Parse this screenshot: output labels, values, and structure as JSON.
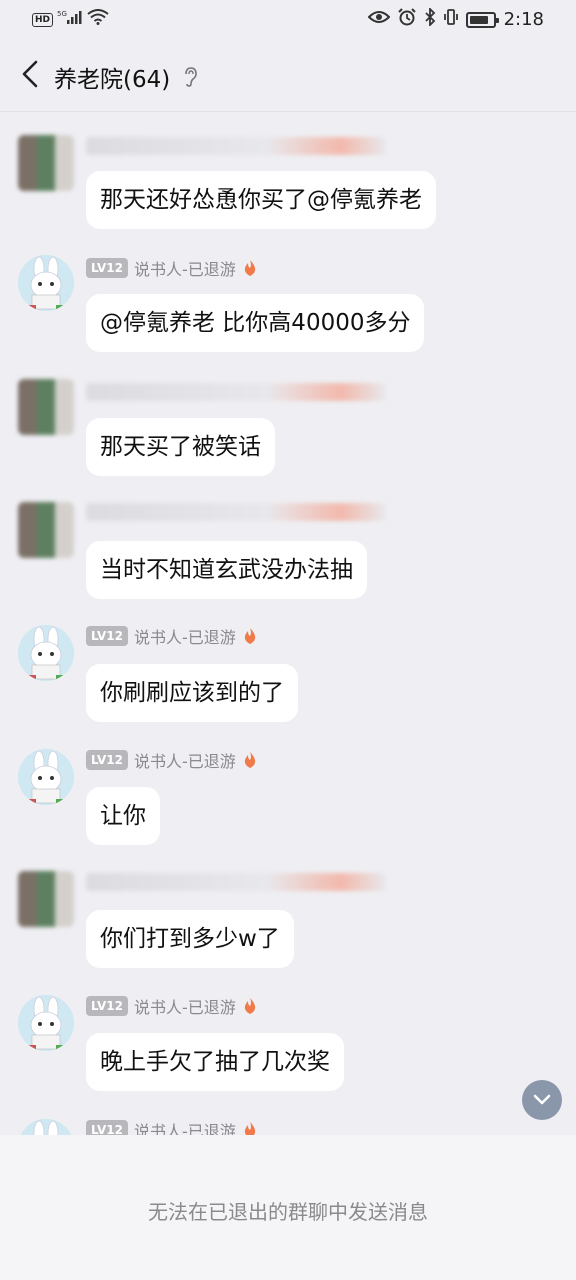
{
  "status_bar": {
    "network_badge": "HD",
    "network_type": "5G",
    "time": "2:18"
  },
  "header": {
    "title": "养老院(64)",
    "back_icon": "chevron-left-icon",
    "mode_icon": "ear-icon"
  },
  "messages": [
    {
      "sender_visible": false,
      "text": "那天还好怂恿你买了@停氪养老"
    },
    {
      "sender_visible": true,
      "level": "LV12",
      "sender": "说书人-已退游",
      "text": "@停氪养老 比你高40000多分"
    },
    {
      "sender_visible": false,
      "text": "那天买了被笑话"
    },
    {
      "sender_visible": false,
      "text": "当时不知道玄武没办法抽"
    },
    {
      "sender_visible": true,
      "level": "LV12",
      "sender": "说书人-已退游",
      "text": "你刷刷应该到的了"
    },
    {
      "sender_visible": true,
      "level": "LV12",
      "sender": "说书人-已退游",
      "text": "让你"
    },
    {
      "sender_visible": false,
      "text": "你们打到多少w了"
    },
    {
      "sender_visible": true,
      "level": "LV12",
      "sender": "说书人-已退游",
      "text": "晚上手欠了抽了几次奖"
    },
    {
      "sender_visible": true,
      "level": "LV12",
      "sender": "说书人-已退游",
      "text": ""
    }
  ],
  "footer": {
    "notice": "无法在已退出的群聊中发送消息"
  },
  "colors": {
    "background": "#efeff3",
    "bubble": "#ffffff",
    "badge": "#b8b8bc",
    "sender_text": "#8a8a8e",
    "scroll_button": "#8a96aa"
  }
}
